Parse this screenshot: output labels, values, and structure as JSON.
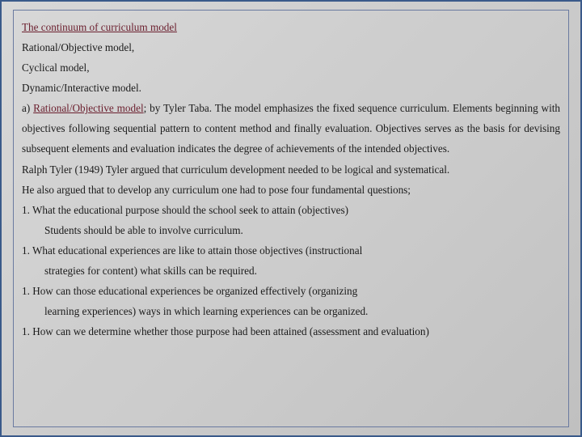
{
  "heading": "The continuum of curriculum model",
  "lines": {
    "l1": "Rational/Objective model,",
    "l2": "Cyclical model,",
    "l3": "Dynamic/Interactive model."
  },
  "sectionA": {
    "prefix": "a) ",
    "link": "Rational/Objective model",
    "rest": "; by Tyler Taba. The model emphasizes the fixed sequence curriculum. Elements beginning with objectives following sequential pattern to content method and finally evaluation. Objectives serves as the basis for devising subsequent elements and evaluation indicates the degree of achievements of the intended objectives."
  },
  "tyler1": "Ralph Tyler (1949) Tyler argued that curriculum development needed to be logical and systematical.",
  "tyler2": "He also argued that to develop any curriculum one had to pose four fundamental questions;",
  "q1": "1. What the educational purpose should the school seek to attain (objectives)",
  "q1sub": "Students should be able to involve curriculum.",
  "q2": "1.  What educational experiences are like to attain those objectives (instructional",
  "q2sub": "strategies for content) what skills can be required.",
  "q3": "1.  How can those educational experiences be organized effectively (organizing",
  "q3sub": "learning experiences) ways in which learning experiences can be organized.",
  "q4": "1. How can we determine whether those purpose had been attained (assessment and evaluation)"
}
